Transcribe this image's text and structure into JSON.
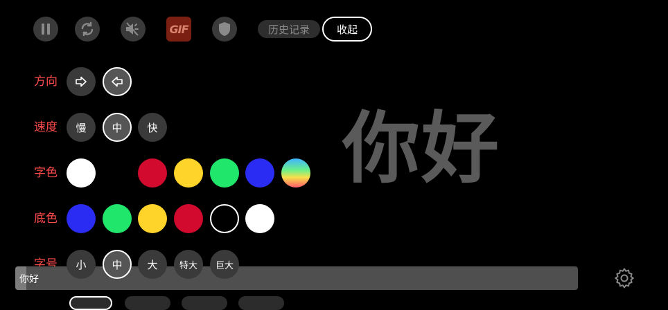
{
  "toolbar": {
    "icons": [
      "pause-icon",
      "refresh-icon",
      "mute-icon",
      "gif-icon",
      "shield-icon"
    ],
    "gif_label": "GIF",
    "history_label": "历史记录",
    "collapse_label": "收起"
  },
  "rows": {
    "direction": {
      "label": "方向",
      "options": [
        "right-arrow-icon",
        "left-arrow-icon"
      ],
      "selected": "left-arrow-icon"
    },
    "speed": {
      "label": "速度",
      "options": [
        "慢",
        "中",
        "快"
      ],
      "selected": "中"
    },
    "text_color": {
      "label": "字色",
      "options": [
        "#ffffff",
        "#000000",
        "#d10a2e",
        "#ffd42a",
        "#21e66c",
        "#2a2cf4",
        "rainbow"
      ]
    },
    "bg_color": {
      "label": "底色",
      "options": [
        "#2a2cf4",
        "#21e66c",
        "#ffd42a",
        "#d10a2e",
        "#000000",
        "#ffffff"
      ],
      "selected": "#000000"
    },
    "font_size": {
      "label": "字号",
      "options": [
        "小",
        "中",
        "大",
        "特大",
        "巨大"
      ],
      "selected": "中"
    }
  },
  "preview": {
    "text": "你好",
    "color": "#5a5a5a"
  },
  "input": {
    "value": "你好"
  },
  "colors": {
    "label_red": "#ff4b4b",
    "button_gray": "#3a3a3a",
    "background": "#000000"
  }
}
